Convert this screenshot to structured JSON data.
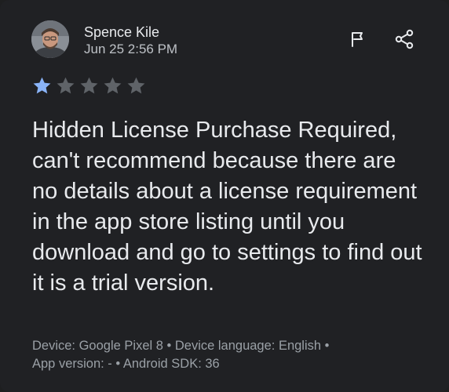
{
  "review": {
    "reviewer_name": "Spence Kile",
    "date": "Jun 25 2:56 PM",
    "rating": 1,
    "max_rating": 5,
    "text": "Hidden License Purchase Required, can't recommend because there are no details about a license requirement in the app store listing until you download and go to settings to find out it is a trial version.",
    "meta_line_1": "Device: Google Pixel 8 • Device language: English •",
    "meta_line_2": "App version: - • Android SDK: 36"
  },
  "actions": {
    "flag_icon": "flag-icon",
    "share_icon": "share-icon"
  },
  "colors": {
    "star_filled": "#8ab4f8",
    "star_empty": "#5f6368",
    "background": "#202124",
    "text_primary": "#e8eaed",
    "text_secondary": "#9aa0a6"
  }
}
